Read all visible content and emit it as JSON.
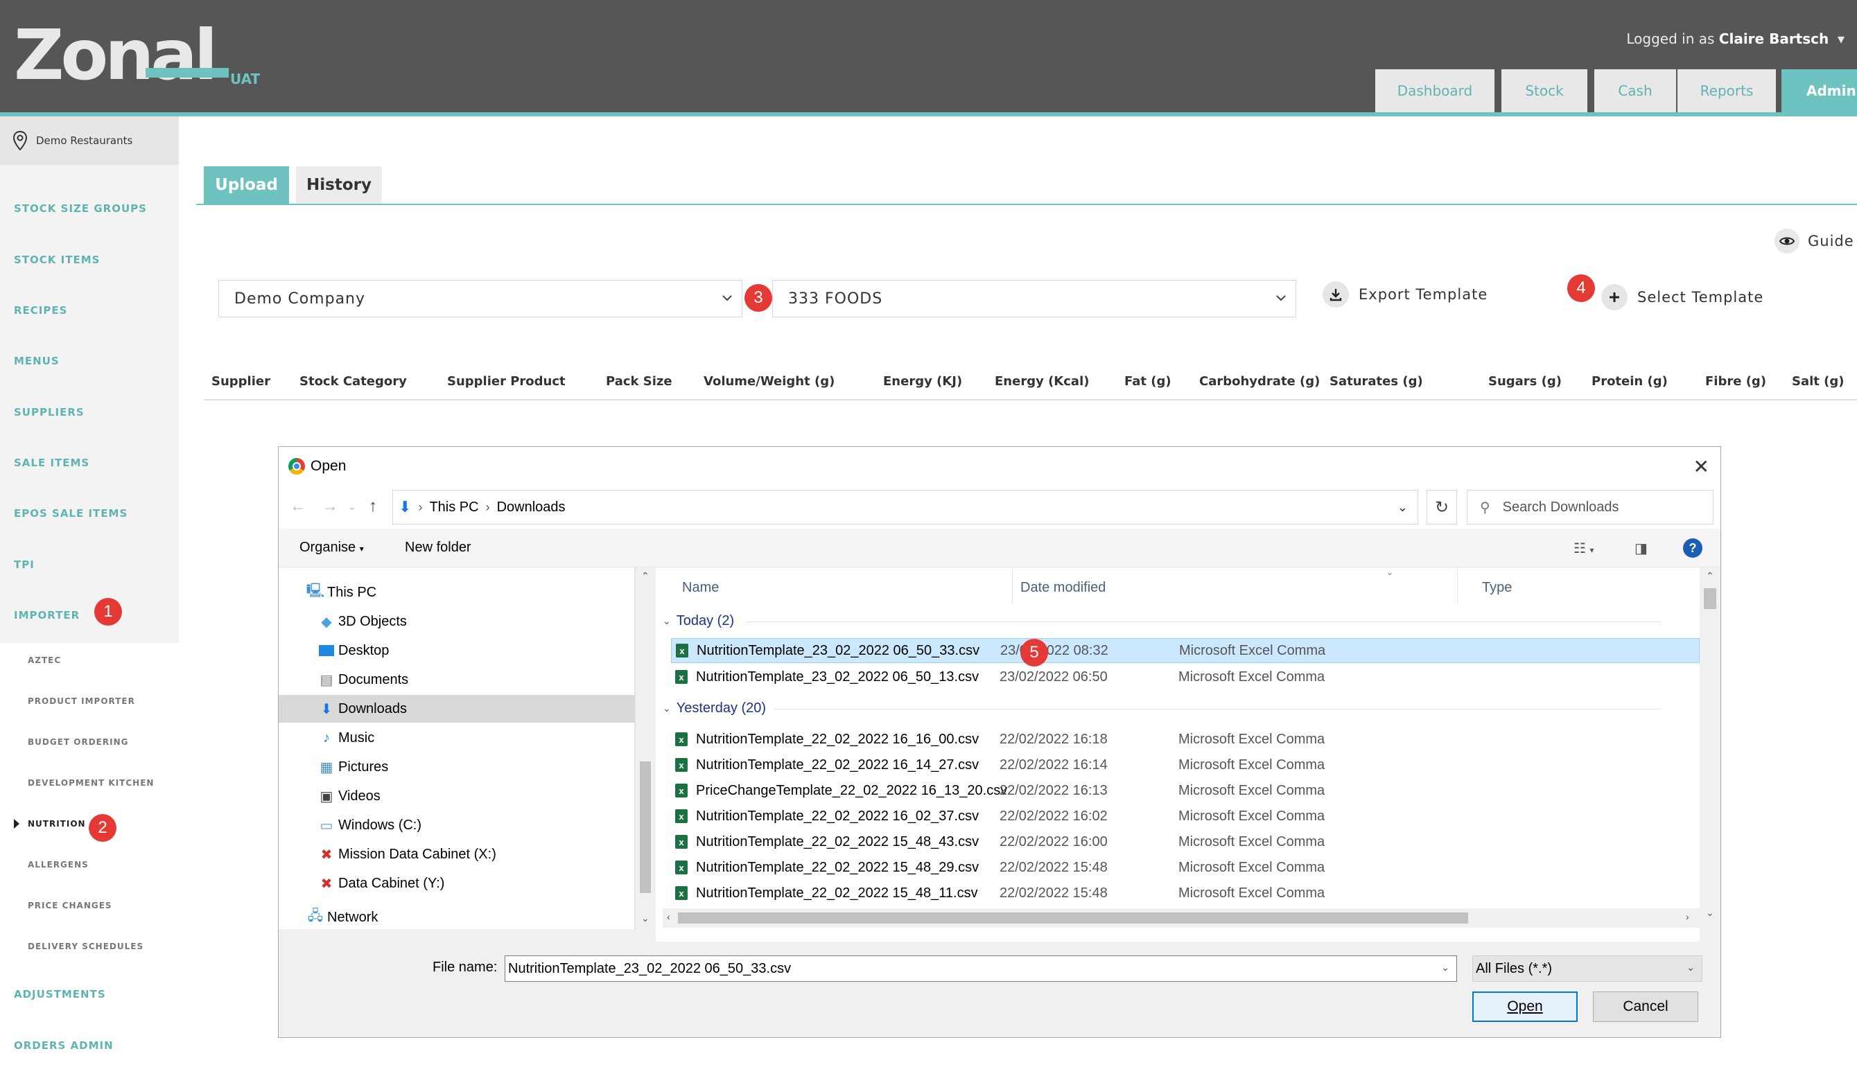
{
  "header": {
    "logo_text": "Zonal",
    "logo_env": "UAT",
    "login_prefix": "Logged in as",
    "login_user": "Claire Bartsch",
    "nav": [
      "Dashboard",
      "Stock",
      "Cash",
      "Reports",
      "Admin"
    ]
  },
  "sidebar": {
    "org": "Demo Restaurants",
    "items": [
      "STOCK SIZE GROUPS",
      "STOCK ITEMS",
      "RECIPES",
      "MENUS",
      "SUPPLIERS",
      "SALE ITEMS",
      "EPOS SALE ITEMS",
      "TPI",
      "IMPORTER"
    ],
    "sub_items": [
      "AZTEC",
      "PRODUCT IMPORTER",
      "BUDGET ORDERING",
      "DEVELOPMENT KITCHEN",
      "NUTRITION",
      "ALLERGENS",
      "PRICE CHANGES",
      "DELIVERY SCHEDULES"
    ],
    "after_items": [
      "ADJUSTMENTS",
      "ORDERS ADMIN"
    ]
  },
  "markers": [
    "1",
    "2",
    "3",
    "4",
    "5"
  ],
  "page": {
    "tabs": [
      "Upload",
      "History"
    ],
    "guide": "Guide",
    "company_select": "Demo Company",
    "supplier_select": "333 FOODS",
    "export_template": "Export Template",
    "select_template": "Select Template",
    "columns": [
      "Supplier",
      "Stock Category",
      "Supplier Product",
      "Pack Size",
      "Volume/Weight (g)",
      "Energy (KJ)",
      "Energy (Kcal)",
      "Fat (g)",
      "Carbohydrate (g)",
      "Saturates (g)",
      "Sugars (g)",
      "Protein (g)",
      "Fibre (g)",
      "Salt (g)"
    ]
  },
  "dialog": {
    "title": "Open",
    "path": [
      "This PC",
      "Downloads"
    ],
    "search_placeholder": "Search Downloads",
    "organise": "Organise",
    "new_folder": "New folder",
    "nav_items": [
      "This PC",
      "3D Objects",
      "Desktop",
      "Documents",
      "Downloads",
      "Music",
      "Pictures",
      "Videos",
      "Windows (C:)",
      "Mission Data Cabinet (X:)",
      "Data Cabinet (Y:)",
      "Network"
    ],
    "headers": [
      "Name",
      "Date modified",
      "Type"
    ],
    "groups": [
      {
        "label": "Today (2)",
        "files": [
          {
            "name": "NutritionTemplate_23_02_2022 06_50_33.csv",
            "date": "23/02/2022 08:32",
            "type": "Microsoft Excel Comma"
          },
          {
            "name": "NutritionTemplate_23_02_2022 06_50_13.csv",
            "date": "23/02/2022 06:50",
            "type": "Microsoft Excel Comma"
          }
        ]
      },
      {
        "label": "Yesterday (20)",
        "files": [
          {
            "name": "NutritionTemplate_22_02_2022 16_16_00.csv",
            "date": "22/02/2022 16:18",
            "type": "Microsoft Excel Comma"
          },
          {
            "name": "NutritionTemplate_22_02_2022 16_14_27.csv",
            "date": "22/02/2022 16:14",
            "type": "Microsoft Excel Comma"
          },
          {
            "name": "PriceChangeTemplate_22_02_2022 16_13_20.csv",
            "date": "22/02/2022 16:13",
            "type": "Microsoft Excel Comma"
          },
          {
            "name": "NutritionTemplate_22_02_2022 16_02_37.csv",
            "date": "22/02/2022 16:02",
            "type": "Microsoft Excel Comma"
          },
          {
            "name": "NutritionTemplate_22_02_2022 15_48_43.csv",
            "date": "22/02/2022 16:00",
            "type": "Microsoft Excel Comma"
          },
          {
            "name": "NutritionTemplate_22_02_2022 15_48_29.csv",
            "date": "22/02/2022 15:48",
            "type": "Microsoft Excel Comma"
          },
          {
            "name": "NutritionTemplate_22_02_2022 15_48_11.csv",
            "date": "22/02/2022 15:48",
            "type": "Microsoft Excel Comma"
          }
        ]
      }
    ],
    "file_name_label": "File name:",
    "file_name_value": "NutritionTemplate_23_02_2022 06_50_33.csv",
    "filter_value": "All Files (*.*)",
    "open_button": "Open",
    "cancel_button": "Cancel"
  },
  "colors": {
    "accent": "#6ec3c1",
    "header_bg": "#565656",
    "marker": "#e53935",
    "selection": "#cce8ff"
  }
}
